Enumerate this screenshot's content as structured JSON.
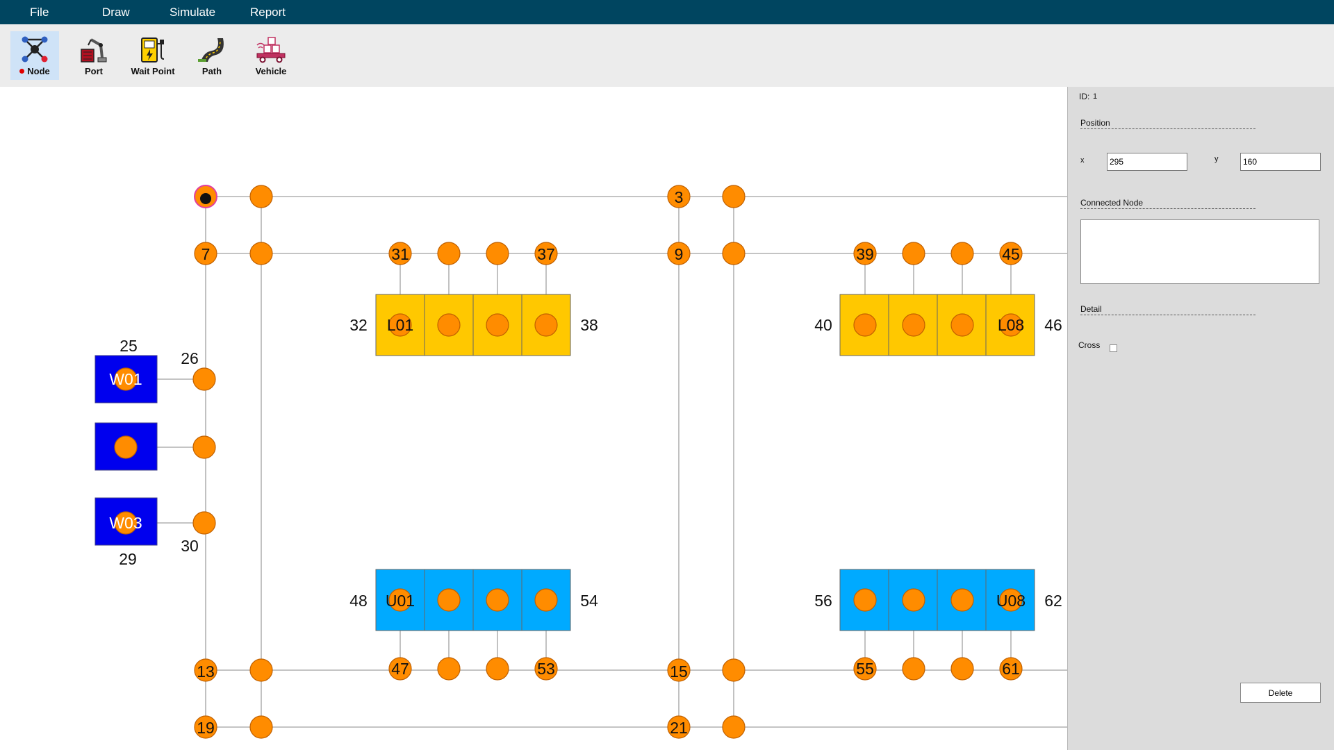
{
  "menu": [
    "File",
    "Draw",
    "Simulate",
    "Report"
  ],
  "toolbar": {
    "node": {
      "label": "Node",
      "icon": "network-nodes-icon",
      "active": true
    },
    "port": {
      "label": "Port",
      "icon": "robot-arm-port-icon"
    },
    "wait_point": {
      "label": "Wait Point",
      "icon": "charging-station-icon"
    },
    "path": {
      "label": "Path",
      "icon": "road-path-icon"
    },
    "vehicle": {
      "label": "Vehicle",
      "icon": "cargo-vehicle-icon"
    }
  },
  "canvas": {
    "node_labels": [
      "3",
      "7",
      "9",
      "13",
      "15",
      "19",
      "21",
      "25",
      "26",
      "29",
      "30",
      "31",
      "32",
      "37",
      "38",
      "39",
      "40",
      "45",
      "46",
      "47",
      "48",
      "53",
      "54",
      "55",
      "56",
      "61",
      "62"
    ],
    "port_labels": [
      "L01",
      "L08",
      "U01",
      "U08"
    ],
    "wait_labels": [
      "W01",
      "W03"
    ],
    "colors": {
      "node": "#ff8c00",
      "node_border": "#c06000",
      "load_port": "#ffc800",
      "unload_port": "#00aaff",
      "wait_point": "#0000ee",
      "path": "#a0a0a0",
      "selected_node": "#e040a0"
    }
  },
  "panel": {
    "id_label": "ID:",
    "id_value": "1",
    "position_title": "Position",
    "x_label": "x",
    "x_value": "295",
    "y_label": "y",
    "y_value": "160",
    "connected_title": "Connected Node",
    "detail_title": "Detail",
    "cross_label": "Cross",
    "delete_label": "Delete"
  }
}
